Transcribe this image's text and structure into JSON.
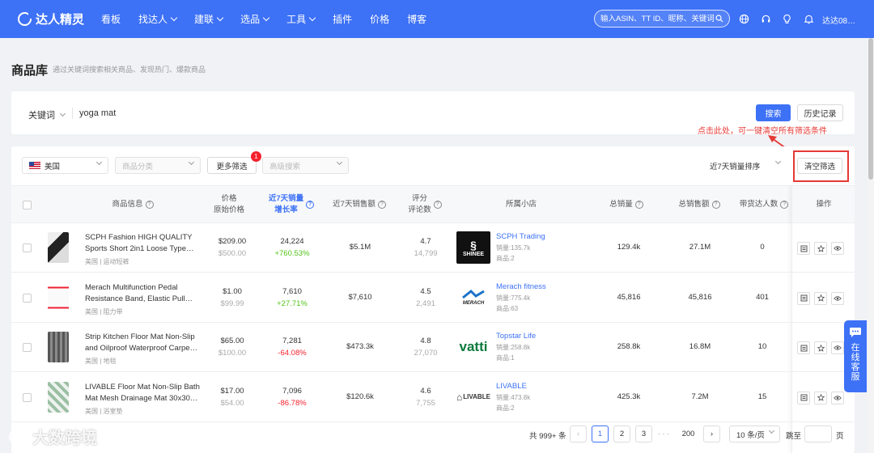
{
  "nav": {
    "brand": "达人精灵",
    "menu": [
      {
        "label": "看板",
        "dropdown": false
      },
      {
        "label": "找达人",
        "dropdown": true
      },
      {
        "label": "建联",
        "dropdown": true
      },
      {
        "label": "选品",
        "dropdown": true
      },
      {
        "label": "工具",
        "dropdown": true
      },
      {
        "label": "插件",
        "dropdown": false
      },
      {
        "label": "价格",
        "dropdown": false
      },
      {
        "label": "博客",
        "dropdown": false
      }
    ],
    "search_placeholder": "输入ASIN、TT ID、昵称、关键词",
    "user": "达达08…",
    "icons": [
      "globe-icon",
      "headset-icon",
      "bulb-icon",
      "bell-icon"
    ]
  },
  "page": {
    "title": "商品库",
    "subtitle": "通过关键词搜索相关商品、发现热门、爆款商品"
  },
  "search": {
    "field_label": "关键词",
    "value": "yoga mat",
    "search_button": "搜索",
    "history_button": "历史记录",
    "annotation": "点击此处，可一键清空所有筛选条件"
  },
  "filters": {
    "country": "美国",
    "category_placeholder": "商品分类",
    "more_button": "更多筛选",
    "more_badge": "1",
    "advanced_placeholder": "高级搜索",
    "sort": "近7天销量排序",
    "clear_button": "清空筛选"
  },
  "table": {
    "headers": {
      "product": "商品信息",
      "price": "价格",
      "price_sub": "原始价格",
      "sales7": "近7天销量",
      "sales7_sub": "增长率",
      "revenue7": "近7天销售额",
      "rating": "评分",
      "rating_sub": "评论数",
      "shop": "所属小店",
      "total_sales": "总销量",
      "total_revenue": "总销售额",
      "creators": "带货达人数",
      "ops": "操作"
    },
    "rows": [
      {
        "name1": "SCPH Fashion HIGH QUALITY",
        "name2": "Sports Short 2in1 Loose Type…",
        "category": "美国 | 运动短裤",
        "price": "$209.00",
        "orig_price": "$500.00",
        "sales7": "24,224",
        "growth": "+760.53%",
        "growth_dir": "up",
        "revenue7": "$5.1M",
        "rating": "4.7",
        "reviews": "14,799",
        "shop": "SCPH Trading",
        "shop_sales": "销量:135.7k",
        "shop_products": "商品:2",
        "shop_logo": "SHINEE",
        "total_sales": "129.4k",
        "total_revenue": "27.1M",
        "creators": "0"
      },
      {
        "name1": "Merach Multifunction Pedal",
        "name2": "Resistance Band, Elastic Pull…",
        "category": "美国 | 阻力带",
        "price": "$1.00",
        "orig_price": "$99.99",
        "sales7": "7,610",
        "growth": "+27.71%",
        "growth_dir": "up",
        "revenue7": "$7,610",
        "rating": "4.5",
        "reviews": "2,491",
        "shop": "Merach fitness",
        "shop_sales": "销量:775.4k",
        "shop_products": "商品:63",
        "shop_logo": "MERACH",
        "total_sales": "45,816",
        "total_revenue": "45,816",
        "creators": "401"
      },
      {
        "name1": "Strip Kitchen Floor Mat Non-Slip",
        "name2": "and Oilproof Waterproof Carpe…",
        "category": "美国 | 地毯",
        "price": "$65.00",
        "orig_price": "$100.00",
        "sales7": "7,281",
        "growth": "-64.08%",
        "growth_dir": "down",
        "revenue7": "$473.3k",
        "rating": "4.8",
        "reviews": "27,070",
        "shop": "Topstar Life",
        "shop_sales": "销量:258.8k",
        "shop_products": "商品:1",
        "shop_logo": "vatti",
        "total_sales": "258.8k",
        "total_revenue": "16.8M",
        "creators": "10"
      },
      {
        "name1": "LIVABLE Floor Mat Non-Slip Bath",
        "name2": "Mat Mesh Drainage Mat 30x30C…",
        "category": "美国 | 浴室垫",
        "price": "$17.00",
        "orig_price": "$54.00",
        "sales7": "7,096",
        "growth": "-86.78%",
        "growth_dir": "down",
        "revenue7": "$120.6k",
        "rating": "4.6",
        "reviews": "7,755",
        "shop": "LIVABLE",
        "shop_sales": "销量:473.8k",
        "shop_products": "商品:2",
        "shop_logo": "LIVABLE",
        "total_sales": "425.3k",
        "total_revenue": "7.2M",
        "creators": "15"
      }
    ]
  },
  "pagination": {
    "total": "共 999+ 条",
    "pages": [
      "1",
      "2",
      "3"
    ],
    "ellipsis": "· · ·",
    "last": "200",
    "page_size": "10 条/页",
    "goto": "跳至",
    "page_unit": "页"
  },
  "float_service": "在线客服",
  "watermark": "大数跨境",
  "colors": {
    "primary": "#3d71f6",
    "danger": "#f5222d",
    "success": "#52c41a",
    "annotation": "#e53935"
  }
}
